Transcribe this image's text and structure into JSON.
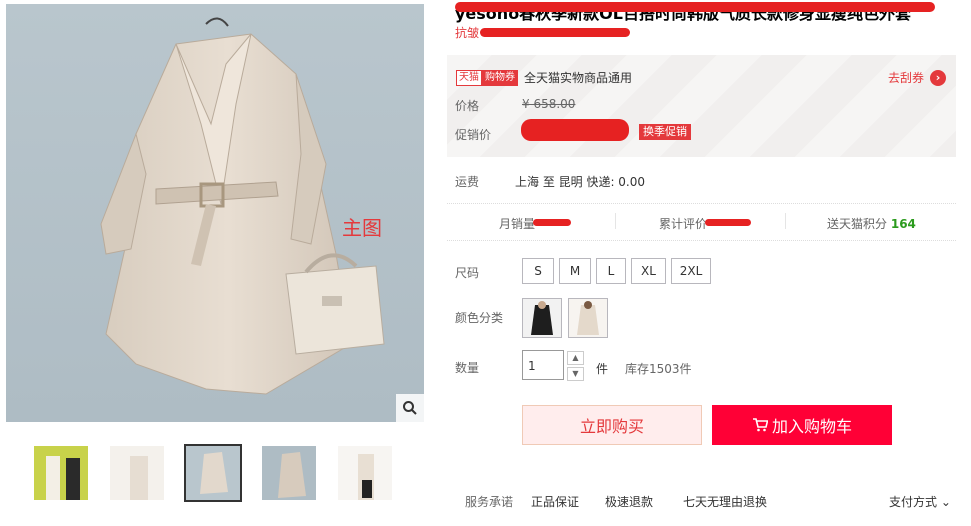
{
  "main_image": {
    "label": "主图"
  },
  "product": {
    "title": "yesono春秋季新款OL百搭时尚韩版气质长款修身显瘦纯色外套",
    "subtitle": "抗皱"
  },
  "promo": {
    "tmall_badge": "天猫",
    "coupon_badge": "购物券",
    "coupon_text": "全天猫实物商品通用",
    "claim_link": "去刮券",
    "price_label": "价格",
    "original_price": "¥ 658.00",
    "promo_price_label": "促销价",
    "promo_tag": "换季促销"
  },
  "shipping": {
    "label": "运费",
    "text": "上海  至  昆明  快递: 0.00"
  },
  "stats": {
    "monthly_sales_label": "月销量",
    "reviews_label": "累计评价",
    "points_label": "送天猫积分",
    "points_value": "164"
  },
  "options": {
    "size_label": "尺码",
    "sizes": [
      "S",
      "M",
      "L",
      "XL",
      "2XL"
    ],
    "color_label": "颜色分类"
  },
  "quantity": {
    "label": "数量",
    "value": "1",
    "unit": "件",
    "stock": "库存1503件"
  },
  "actions": {
    "buy_now": "立即购买",
    "add_to_cart": "加入购物车"
  },
  "services": {
    "label": "服务承诺",
    "items": [
      "正品保证",
      "极速退款",
      "七天无理由退换"
    ],
    "payment": "支付方式"
  },
  "colors": {
    "accent": "#e4393c",
    "cart_button": "#ff0036",
    "points": "#2b9b1d"
  },
  "icons": [
    "search-icon",
    "chevron-right-icon",
    "chevron-down-icon",
    "cart-icon",
    "caret-up-icon",
    "caret-down-icon"
  ]
}
